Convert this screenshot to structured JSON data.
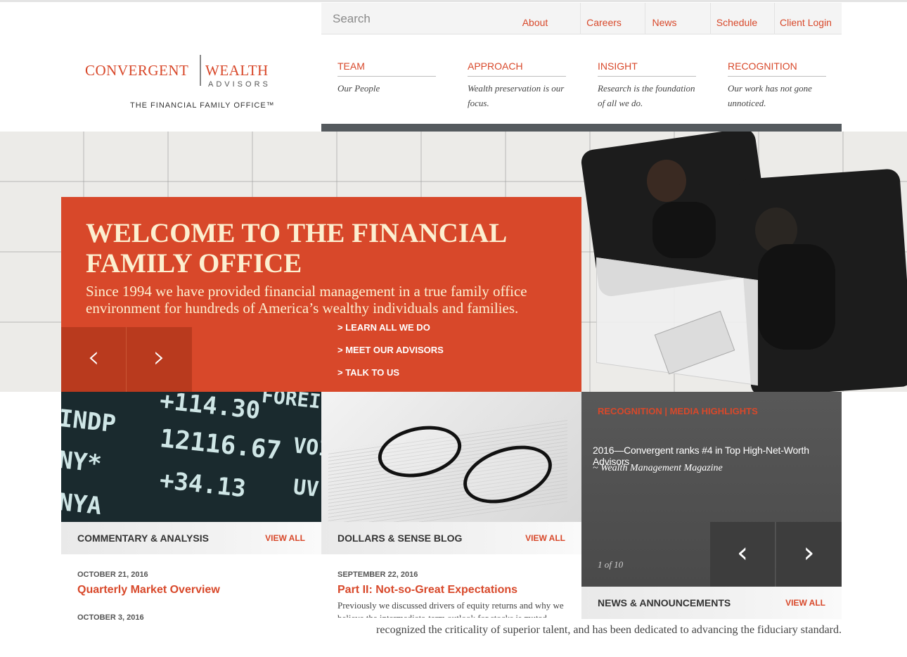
{
  "utility_nav": {
    "search_placeholder": "Search",
    "links": [
      "About",
      "Careers",
      "News",
      "Schedule",
      "Client Login"
    ]
  },
  "logo": {
    "word1": "CONVERGENT",
    "word2": "WEALTH",
    "word3": "ADVISORS",
    "tagline": "THE FINANCIAL FAMILY OFFICE™"
  },
  "main_nav": [
    {
      "title": "TEAM",
      "desc": "Our People"
    },
    {
      "title": "APPROACH",
      "desc": "Wealth preservation is our focus."
    },
    {
      "title": "INSIGHT",
      "desc": "Research is the foundation of all we do."
    },
    {
      "title": "RECOGNITION",
      "desc": "Our work has not gone unnoticed."
    }
  ],
  "hero": {
    "title": "WELCOME TO THE FINANCIAL FAMILY OFFICE",
    "subtitle": "Since 1994 we have provided financial management in a true family office environment for hundreds of America’s wealthy individuals and families.",
    "links": [
      "> LEARN ALL WE DO",
      "> MEET OUR ADVISORS",
      "> TALK TO US"
    ],
    "prev_glyph": "‹",
    "next_glyph": "›"
  },
  "ticker_lines": [
    "+114.30",
    "12116.67",
    "+34.13",
    "INDP",
    "NY*",
    "NYA",
    "FOREIG",
    "VOI",
    "UV"
  ],
  "commentary": {
    "title": "COMMENTARY & ANALYSIS",
    "view_all": "VIEW ALL",
    "posts": [
      {
        "date": "OCTOBER 21, 2016",
        "title": "Quarterly Market Overview"
      },
      {
        "date": "OCTOBER 3, 2016",
        "title": ""
      }
    ]
  },
  "blog": {
    "title": "DOLLARS & SENSE BLOG",
    "view_all": "VIEW ALL",
    "post": {
      "date": "SEPTEMBER 22, 2016",
      "title": "Part II: Not-so-Great Expectations",
      "excerpt": "Previously we discussed drivers of equity returns and why we believe the intermediate-term outlook for stocks is muted."
    }
  },
  "recognition": {
    "label": "RECOGNITION | MEDIA HIGHLIGHTS",
    "quote": "2016—Convergent ranks #4 in Top High-Net-Worth Advisors",
    "source": "~ Wealth Management Magazine",
    "count": "1 of 10",
    "prev_glyph": "‹",
    "next_glyph": "›"
  },
  "news": {
    "title": "NEWS & ANNOUNCEMENTS",
    "view_all": "VIEW ALL"
  },
  "footer_text": "recognized the criticality of superior talent, and has been dedicated to advancing the fiduciary standard.",
  "colors": {
    "accent": "#d8482a",
    "dark_panel": "#4f4f4f",
    "nav_rule": "#555a5e"
  }
}
